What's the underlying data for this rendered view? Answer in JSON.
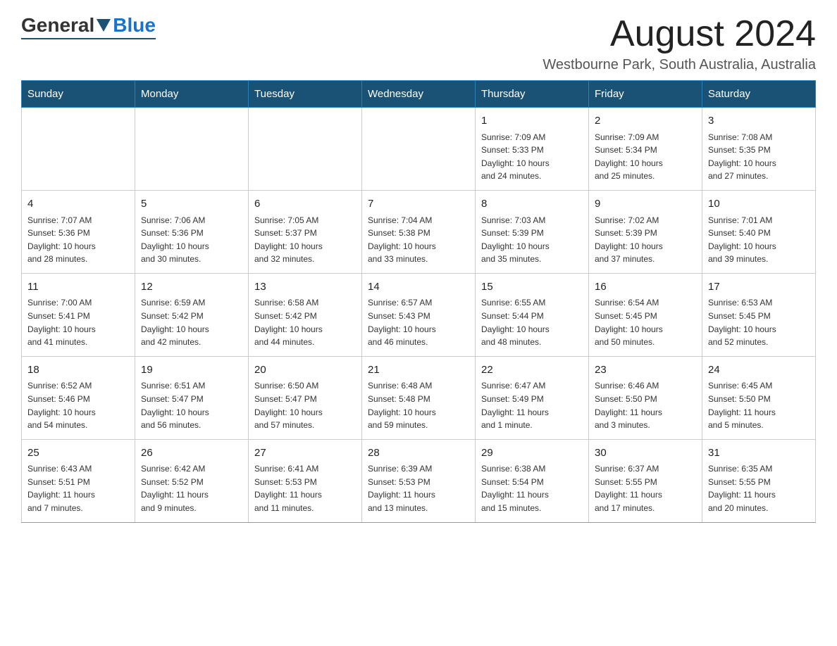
{
  "header": {
    "logo_general": "General",
    "logo_blue": "Blue",
    "month_title": "August 2024",
    "location": "Westbourne Park, South Australia, Australia"
  },
  "days_of_week": [
    "Sunday",
    "Monday",
    "Tuesday",
    "Wednesday",
    "Thursday",
    "Friday",
    "Saturday"
  ],
  "weeks": [
    [
      {
        "day": "",
        "info": ""
      },
      {
        "day": "",
        "info": ""
      },
      {
        "day": "",
        "info": ""
      },
      {
        "day": "",
        "info": ""
      },
      {
        "day": "1",
        "info": "Sunrise: 7:09 AM\nSunset: 5:33 PM\nDaylight: 10 hours\nand 24 minutes."
      },
      {
        "day": "2",
        "info": "Sunrise: 7:09 AM\nSunset: 5:34 PM\nDaylight: 10 hours\nand 25 minutes."
      },
      {
        "day": "3",
        "info": "Sunrise: 7:08 AM\nSunset: 5:35 PM\nDaylight: 10 hours\nand 27 minutes."
      }
    ],
    [
      {
        "day": "4",
        "info": "Sunrise: 7:07 AM\nSunset: 5:36 PM\nDaylight: 10 hours\nand 28 minutes."
      },
      {
        "day": "5",
        "info": "Sunrise: 7:06 AM\nSunset: 5:36 PM\nDaylight: 10 hours\nand 30 minutes."
      },
      {
        "day": "6",
        "info": "Sunrise: 7:05 AM\nSunset: 5:37 PM\nDaylight: 10 hours\nand 32 minutes."
      },
      {
        "day": "7",
        "info": "Sunrise: 7:04 AM\nSunset: 5:38 PM\nDaylight: 10 hours\nand 33 minutes."
      },
      {
        "day": "8",
        "info": "Sunrise: 7:03 AM\nSunset: 5:39 PM\nDaylight: 10 hours\nand 35 minutes."
      },
      {
        "day": "9",
        "info": "Sunrise: 7:02 AM\nSunset: 5:39 PM\nDaylight: 10 hours\nand 37 minutes."
      },
      {
        "day": "10",
        "info": "Sunrise: 7:01 AM\nSunset: 5:40 PM\nDaylight: 10 hours\nand 39 minutes."
      }
    ],
    [
      {
        "day": "11",
        "info": "Sunrise: 7:00 AM\nSunset: 5:41 PM\nDaylight: 10 hours\nand 41 minutes."
      },
      {
        "day": "12",
        "info": "Sunrise: 6:59 AM\nSunset: 5:42 PM\nDaylight: 10 hours\nand 42 minutes."
      },
      {
        "day": "13",
        "info": "Sunrise: 6:58 AM\nSunset: 5:42 PM\nDaylight: 10 hours\nand 44 minutes."
      },
      {
        "day": "14",
        "info": "Sunrise: 6:57 AM\nSunset: 5:43 PM\nDaylight: 10 hours\nand 46 minutes."
      },
      {
        "day": "15",
        "info": "Sunrise: 6:55 AM\nSunset: 5:44 PM\nDaylight: 10 hours\nand 48 minutes."
      },
      {
        "day": "16",
        "info": "Sunrise: 6:54 AM\nSunset: 5:45 PM\nDaylight: 10 hours\nand 50 minutes."
      },
      {
        "day": "17",
        "info": "Sunrise: 6:53 AM\nSunset: 5:45 PM\nDaylight: 10 hours\nand 52 minutes."
      }
    ],
    [
      {
        "day": "18",
        "info": "Sunrise: 6:52 AM\nSunset: 5:46 PM\nDaylight: 10 hours\nand 54 minutes."
      },
      {
        "day": "19",
        "info": "Sunrise: 6:51 AM\nSunset: 5:47 PM\nDaylight: 10 hours\nand 56 minutes."
      },
      {
        "day": "20",
        "info": "Sunrise: 6:50 AM\nSunset: 5:47 PM\nDaylight: 10 hours\nand 57 minutes."
      },
      {
        "day": "21",
        "info": "Sunrise: 6:48 AM\nSunset: 5:48 PM\nDaylight: 10 hours\nand 59 minutes."
      },
      {
        "day": "22",
        "info": "Sunrise: 6:47 AM\nSunset: 5:49 PM\nDaylight: 11 hours\nand 1 minute."
      },
      {
        "day": "23",
        "info": "Sunrise: 6:46 AM\nSunset: 5:50 PM\nDaylight: 11 hours\nand 3 minutes."
      },
      {
        "day": "24",
        "info": "Sunrise: 6:45 AM\nSunset: 5:50 PM\nDaylight: 11 hours\nand 5 minutes."
      }
    ],
    [
      {
        "day": "25",
        "info": "Sunrise: 6:43 AM\nSunset: 5:51 PM\nDaylight: 11 hours\nand 7 minutes."
      },
      {
        "day": "26",
        "info": "Sunrise: 6:42 AM\nSunset: 5:52 PM\nDaylight: 11 hours\nand 9 minutes."
      },
      {
        "day": "27",
        "info": "Sunrise: 6:41 AM\nSunset: 5:53 PM\nDaylight: 11 hours\nand 11 minutes."
      },
      {
        "day": "28",
        "info": "Sunrise: 6:39 AM\nSunset: 5:53 PM\nDaylight: 11 hours\nand 13 minutes."
      },
      {
        "day": "29",
        "info": "Sunrise: 6:38 AM\nSunset: 5:54 PM\nDaylight: 11 hours\nand 15 minutes."
      },
      {
        "day": "30",
        "info": "Sunrise: 6:37 AM\nSunset: 5:55 PM\nDaylight: 11 hours\nand 17 minutes."
      },
      {
        "day": "31",
        "info": "Sunrise: 6:35 AM\nSunset: 5:55 PM\nDaylight: 11 hours\nand 20 minutes."
      }
    ]
  ]
}
